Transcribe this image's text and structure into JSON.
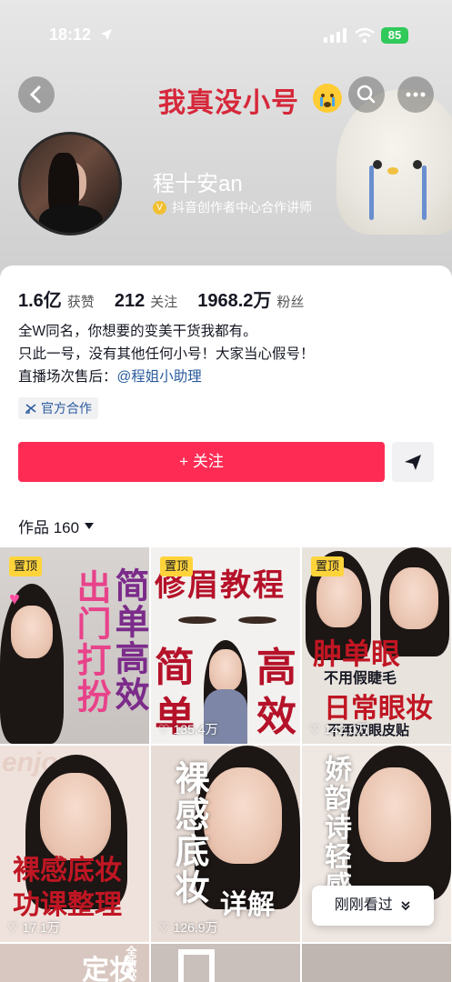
{
  "status_bar": {
    "time": "18:12",
    "battery": "85"
  },
  "header": {
    "title": "我真没小号"
  },
  "profile": {
    "name": "程十安an",
    "verification": "抖音创作者中心合作讲师"
  },
  "stats": [
    {
      "value": "1.6亿",
      "label": "获赞"
    },
    {
      "value": "212",
      "label": "关注"
    },
    {
      "value": "1968.2万",
      "label": "粉丝"
    }
  ],
  "bio": {
    "line1": "全W同名，你想要的变美干货我都有。",
    "line2": "只此一号，没有其他任何小号！大家当心假号！",
    "line3_prefix": "直播场次售后：",
    "line3_mention": "@程姐小助理"
  },
  "tag": "官方合作",
  "follow_button": "+ 关注",
  "works_label": "作品 160",
  "videos": [
    {
      "pinned": "置顶",
      "title_a": "出门打扮",
      "title_b": "简单高效",
      "likes": ""
    },
    {
      "pinned": "置顶",
      "title_a": "修眉教程",
      "title_b": "简",
      "title_c": "高",
      "title_d": "单",
      "title_e": "效",
      "likes": "135.4万"
    },
    {
      "pinned": "置顶",
      "title_a": "肿单眼",
      "title_b": "不用假睫毛",
      "title_c": "日常眼妆",
      "title_d": "不用双眼皮贴",
      "likes": "142.0万"
    },
    {
      "pinned": "",
      "title_a": "裸感底妆",
      "title_b": "功课整理",
      "title_c": "enjoy",
      "likes": "17.1万"
    },
    {
      "pinned": "",
      "title_a": "裸感底妆",
      "title_b": "详解",
      "likes": "126.9万"
    },
    {
      "pinned": "",
      "title_a": "娇韵诗轻感",
      "likes": ""
    }
  ],
  "recent_button": "刚刚看过",
  "partial_row": [
    "定妆",
    "全新欧"
  ]
}
